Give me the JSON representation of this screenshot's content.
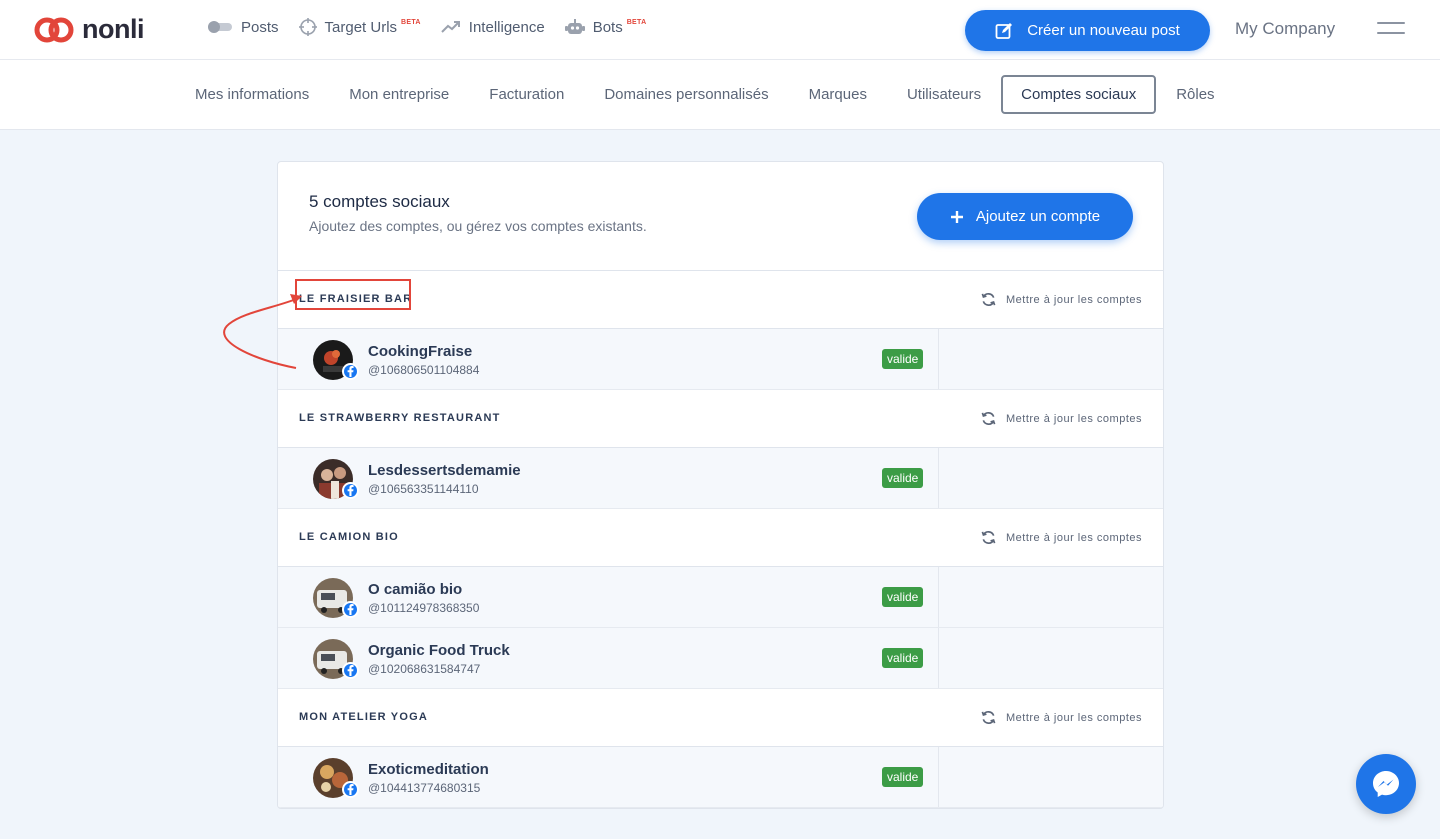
{
  "brand": {
    "name": "nonli",
    "accent": "#1f75e8",
    "logo_color": "#e2453a"
  },
  "nav": {
    "items": [
      {
        "label": "Posts",
        "icon": "toggle-icon",
        "beta": ""
      },
      {
        "label": "Target Urls",
        "icon": "crosshair-icon",
        "beta": "BETA"
      },
      {
        "label": "Intelligence",
        "icon": "trend-up-icon",
        "beta": ""
      },
      {
        "label": "Bots",
        "icon": "robot-icon",
        "beta": "BETA"
      }
    ],
    "create_label": "Créer un nouveau post",
    "company": "My Company"
  },
  "subnav": {
    "tabs": [
      {
        "label": "Mes informations",
        "active": false
      },
      {
        "label": "Mon entreprise",
        "active": false
      },
      {
        "label": "Facturation",
        "active": false
      },
      {
        "label": "Domaines personnalisés",
        "active": false
      },
      {
        "label": "Marques",
        "active": false
      },
      {
        "label": "Utilisateurs",
        "active": false
      },
      {
        "label": "Comptes sociaux",
        "active": true
      },
      {
        "label": "Rôles",
        "active": false
      }
    ]
  },
  "card": {
    "title": "5 comptes sociaux",
    "subtitle": "Ajoutez des comptes, ou gérez vos comptes existants.",
    "add_label": "Ajoutez un compte",
    "update_label": "Mettre à jour les comptes",
    "groups": [
      {
        "name": "LE FRAISIER BAR",
        "accounts": [
          {
            "name": "CookingFraise",
            "handle": "@106806501104884",
            "status": "valide",
            "avatar": "dark-food"
          }
        ]
      },
      {
        "name": "LE STRAWBERRY RESTAURANT",
        "accounts": [
          {
            "name": "Lesdessertsdemamie",
            "handle": "@106563351144110",
            "status": "valide",
            "avatar": "people"
          }
        ]
      },
      {
        "name": "LE CAMION BIO",
        "accounts": [
          {
            "name": "O camião bio",
            "handle": "@101124978368350",
            "status": "valide",
            "avatar": "truck"
          },
          {
            "name": "Organic Food Truck",
            "handle": "@102068631584747",
            "status": "valide",
            "avatar": "truck"
          }
        ]
      },
      {
        "name": "MON ATELIER YOGA",
        "accounts": [
          {
            "name": "Exoticmeditation",
            "handle": "@104413774680315",
            "status": "valide",
            "avatar": "food-plate"
          }
        ]
      }
    ]
  }
}
